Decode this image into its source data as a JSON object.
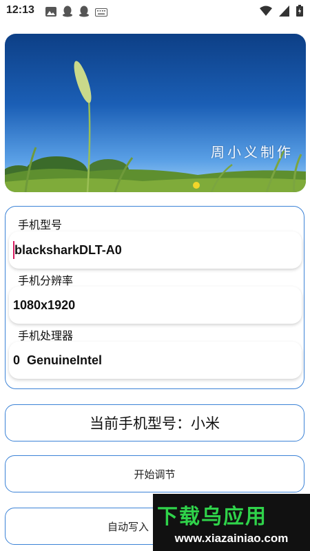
{
  "status_bar": {
    "time": "12:13"
  },
  "banner": {
    "caption": "周小义制作"
  },
  "device_info": {
    "model_label": "手机型号",
    "model_value": "blacksharkDLT-A0",
    "resolution_label": "手机分辨率",
    "resolution_value": "1080x1920",
    "processor_label": "手机处理器",
    "processor_value": "0  GenuineIntel"
  },
  "current_model": {
    "text": "当前手机型号：小米"
  },
  "buttons": {
    "start_label": "开始调节",
    "auto_write_label": "自动写入"
  },
  "watermark": {
    "title": "下载乌应用",
    "url": "www.xiazainiao.com"
  },
  "colors": {
    "accent_border": "#3b82d6",
    "cursor": "#d81b60",
    "watermark_green": "#2fd34a"
  }
}
